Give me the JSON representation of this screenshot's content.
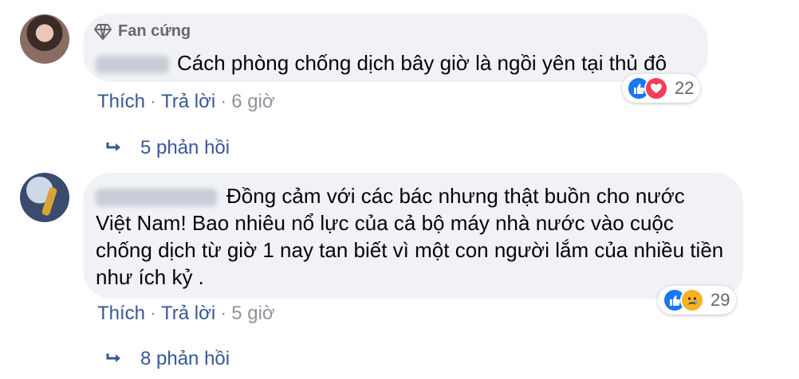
{
  "comments": [
    {
      "badge": "Fan cứng",
      "text": "Cách phòng chống dịch bây giờ là ngồi yên tại thủ đô",
      "actions": {
        "like": "Thích",
        "reply": "Trả lời",
        "time": "6 giờ"
      },
      "reactions": {
        "icons": [
          "like-icon",
          "love-icon"
        ],
        "count": "22"
      },
      "replies": "5 phản hồi"
    },
    {
      "text": "Đồng cảm với các bác nhưng thật buồn cho nước Việt Nam! Bao nhiêu nổ lực của cả bộ máy nhà nước vào cuộc chống dịch từ giờ 1 nay tan biết vì một con người lắm của nhiều tiền như ích kỷ .",
      "actions": {
        "like": "Thích",
        "reply": "Trả lời",
        "time": "5 giờ"
      },
      "reactions": {
        "icons": [
          "like-icon",
          "sad-icon"
        ],
        "count": "29"
      },
      "replies": "8 phản hồi"
    }
  ],
  "colors": {
    "link": "#385898",
    "bubble": "#f0f2f5",
    "like": "#1877f2",
    "love": "#f33e58",
    "sad": "#f7b125"
  }
}
